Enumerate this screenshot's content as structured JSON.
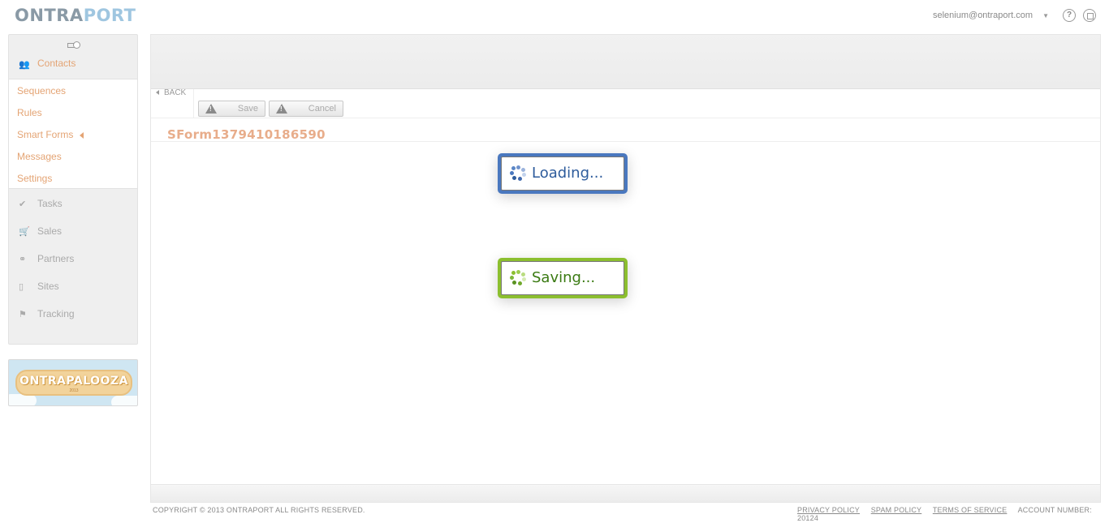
{
  "brand": {
    "logo_part1": "ONTRA",
    "logo_part2": "PORT"
  },
  "header": {
    "user_email": "selenium@ontraport.com",
    "help_icon": "help-circle-icon",
    "docs_icon": "docs-icon"
  },
  "sidebar": {
    "section": "Contacts",
    "sub_items": [
      {
        "label": "Sequences"
      },
      {
        "label": "Rules"
      },
      {
        "label": "Smart Forms"
      },
      {
        "label": "Messages"
      },
      {
        "label": "Settings"
      }
    ],
    "nav_items": [
      {
        "label": "Tasks",
        "icon": "check-icon"
      },
      {
        "label": "Sales",
        "icon": "cart-icon"
      },
      {
        "label": "Partners",
        "icon": "handshake-icon"
      },
      {
        "label": "Sites",
        "icon": "page-icon"
      },
      {
        "label": "Tracking",
        "icon": "flag-icon"
      }
    ]
  },
  "promo": {
    "text": "ONTRAPALOOZA",
    "year": "2013"
  },
  "toolbar": {
    "back_label": "BACK",
    "save_label": "Save",
    "cancel_label": "Cancel"
  },
  "form": {
    "title": "SForm1379410186590"
  },
  "overlays": {
    "loading_label": "Loading...",
    "saving_label": "Saving...",
    "loading_color": "#4a78bf",
    "saving_color": "#8cbf2f"
  },
  "footer": {
    "copyright": "COPYRIGHT © 2013 ONTRAPORT ALL RIGHTS RESERVED.",
    "links": [
      "PRIVACY POLICY",
      "SPAM POLICY",
      "TERMS OF SERVICE"
    ],
    "account_number": "ACCOUNT NUMBER: 20124"
  },
  "colors": {
    "accent": "#e4a474",
    "muted": "#aaaaaa"
  }
}
